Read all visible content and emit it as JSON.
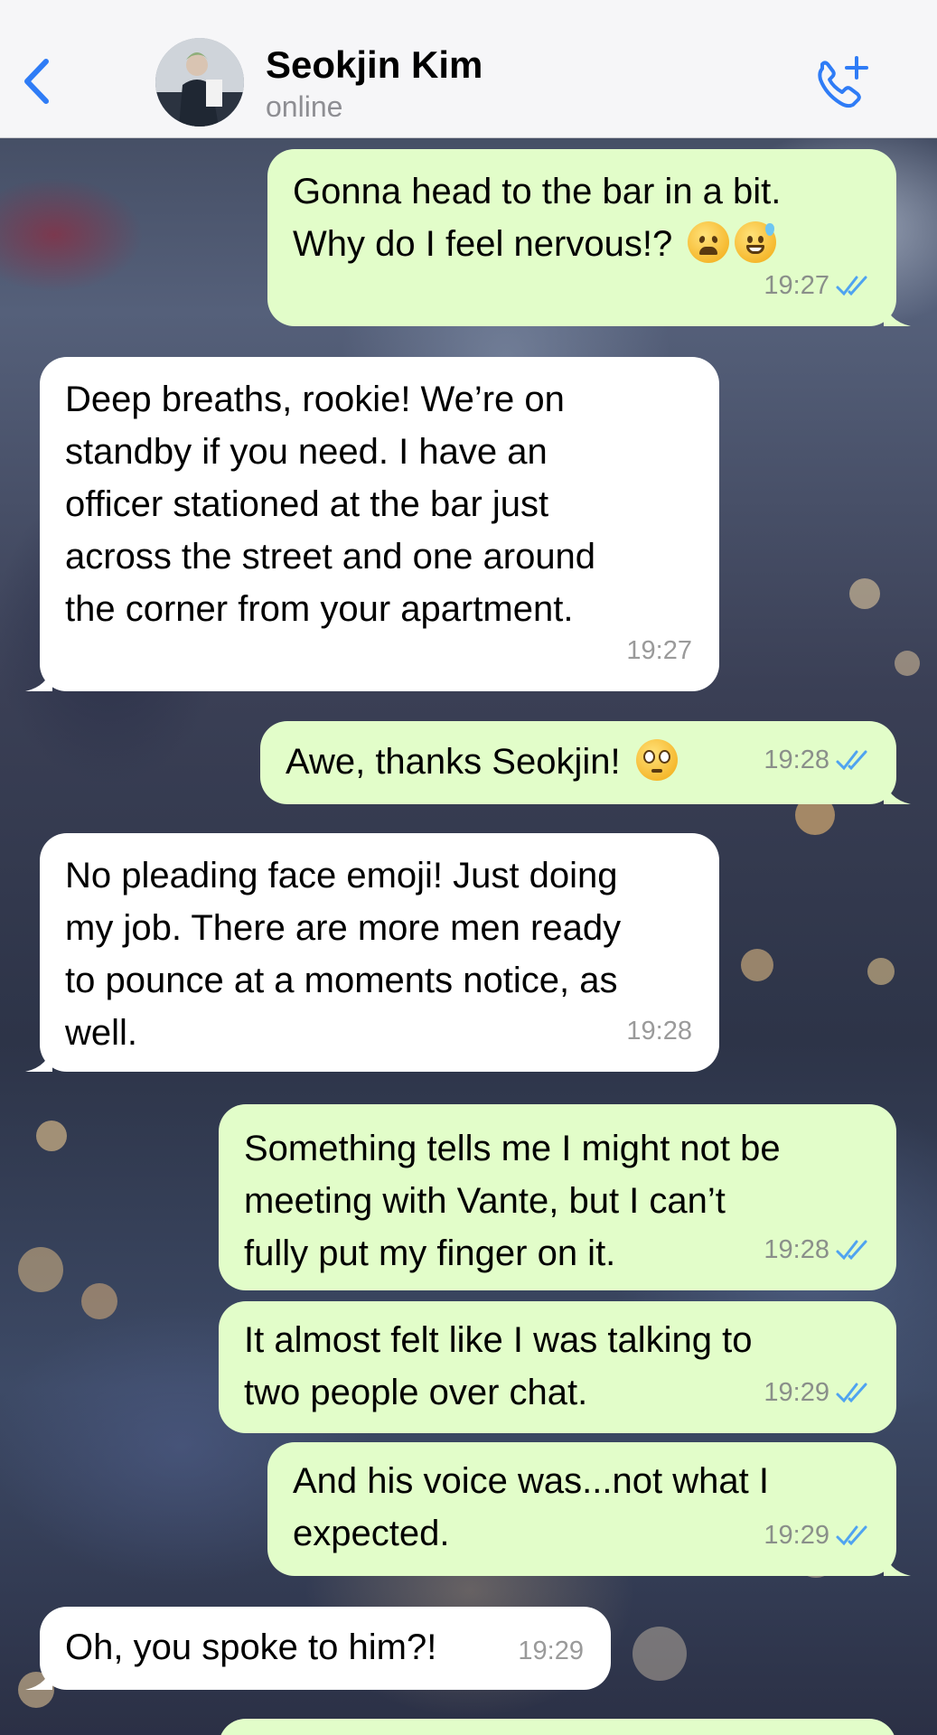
{
  "header": {
    "contact_name": "Seokjin Kim",
    "status": "online"
  },
  "messages": [
    {
      "direction": "outgoing",
      "text": "Gonna head to the bar in a bit.\nWhy do I feel nervous!? ",
      "emoji": [
        "weary-face",
        "grinning-sweat-face"
      ],
      "time": "19:27",
      "read": true
    },
    {
      "direction": "incoming",
      "text": "Deep breaths, rookie! We’re on\nstandby if you need. I have an\nofficer stationed at the bar just\nacross the street and one around\nthe corner from your apartment.",
      "time": "19:27"
    },
    {
      "direction": "outgoing",
      "text": "Awe, thanks Seokjin! ",
      "emoji": [
        "pleading-face"
      ],
      "time": "19:28",
      "read": true
    },
    {
      "direction": "incoming",
      "text": "No pleading face emoji! Just doing\nmy job. There are more men ready\nto pounce at a moments notice, as\nwell.",
      "time": "19:28"
    },
    {
      "direction": "outgoing",
      "text": "Something tells me I might not be\nmeeting with Vante, but I can’t\nfully put my finger on it.",
      "time": "19:28",
      "read": true
    },
    {
      "direction": "outgoing",
      "text": "It almost felt like I was talking to\ntwo people over chat.",
      "time": "19:29",
      "read": true
    },
    {
      "direction": "outgoing",
      "text": "And his voice was...not what I\nexpected.",
      "time": "19:29",
      "read": true
    },
    {
      "direction": "incoming",
      "text": "Oh, you spoke to him?!",
      "time": "19:29"
    }
  ],
  "icons": {
    "back": "chevron-left-icon",
    "call": "phone-plus-icon",
    "read_receipt": "double-check-icon"
  },
  "colors": {
    "accent": "#2f7cf6",
    "outgoing_bubble": "#e2fdc9",
    "incoming_bubble": "#ffffff",
    "header_bg": "#f6f6f8",
    "read_tick": "#4fa3f0"
  }
}
